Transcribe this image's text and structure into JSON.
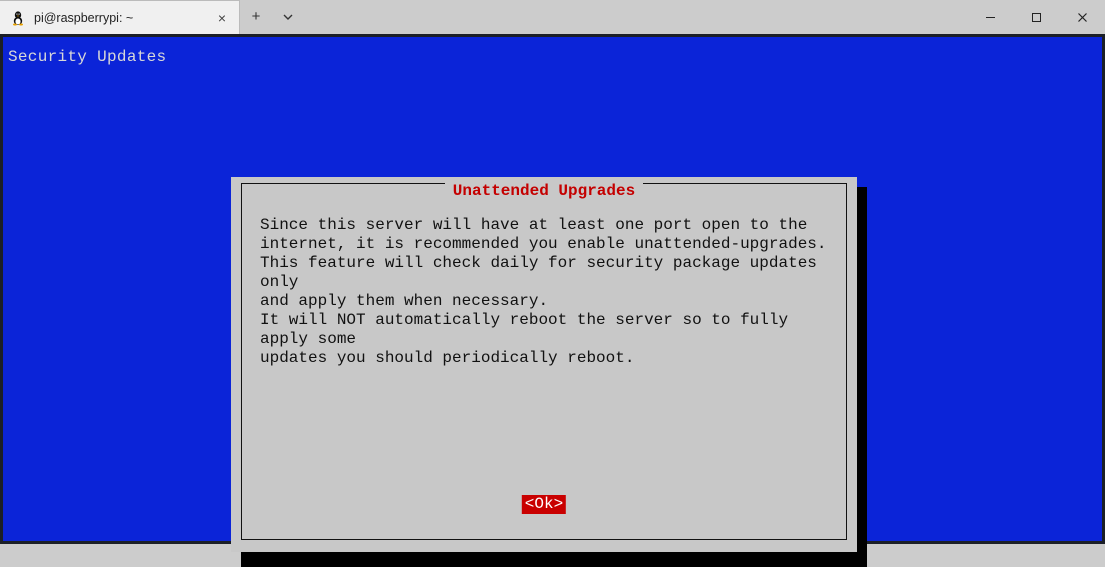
{
  "titlebar": {
    "tab_title": "pi@raspberrypi: ~",
    "tab_icon": "tux-icon",
    "tab_close": "×",
    "new_tab": "+",
    "dropdown": "⌄",
    "minimize": "min",
    "maximize": "max",
    "close": "close"
  },
  "terminal": {
    "screen_header": "Security Updates",
    "dialog": {
      "title": "Unattended Upgrades",
      "body": "Since this server will have at least one port open to the\ninternet, it is recommended you enable unattended-upgrades.\nThis feature will check daily for security package updates only\nand apply them when necessary.\nIt will NOT automatically reboot the server so to fully apply some\nupdates you should periodically reboot.",
      "ok_label": "<Ok>"
    }
  },
  "colors": {
    "terminal_blue": "#0b24d8",
    "dialog_gray": "#c8c8c8",
    "accent_red": "#c90000",
    "title_red": "#c40000"
  }
}
